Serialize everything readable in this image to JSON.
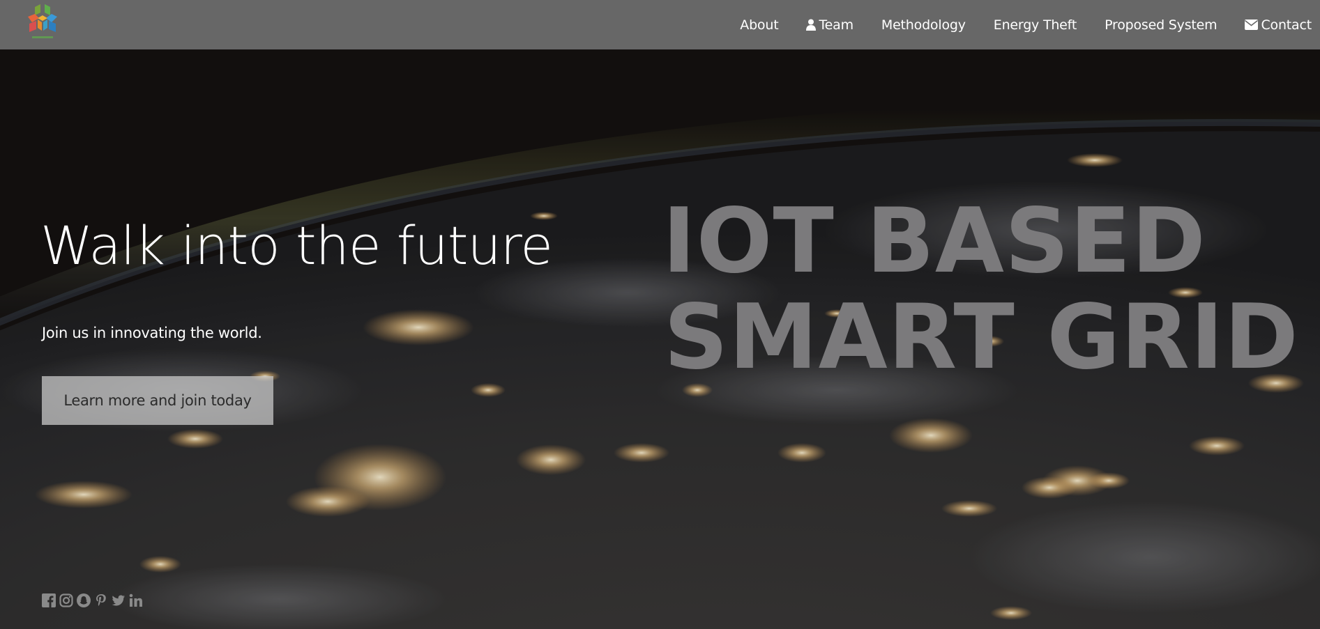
{
  "navbar": {
    "logo_icon": "cube-logo-icon",
    "links": [
      {
        "label": "About",
        "icon": ""
      },
      {
        "label": "Team",
        "icon": "user-icon"
      },
      {
        "label": "Methodology",
        "icon": ""
      },
      {
        "label": "Energy Theft",
        "icon": ""
      },
      {
        "label": "Proposed System",
        "icon": ""
      },
      {
        "label": "Contact",
        "icon": "envelope-icon"
      }
    ]
  },
  "hero": {
    "title": "Walk into the future",
    "subtitle": "Join us in innovating the world.",
    "cta_label": "Learn more and join today",
    "headline_line1": "IOT BASED",
    "headline_line2": "SMART GRID"
  },
  "social": {
    "icons": [
      "facebook-icon",
      "instagram-icon",
      "snapchat-icon",
      "pinterest-icon",
      "twitter-icon",
      "linkedin-icon"
    ]
  },
  "colors": {
    "navbar_bg": "#676767",
    "headline": "#7b7a7c",
    "cta_bg": "#c8c8c8",
    "city_lights": "#f6d9a0"
  }
}
